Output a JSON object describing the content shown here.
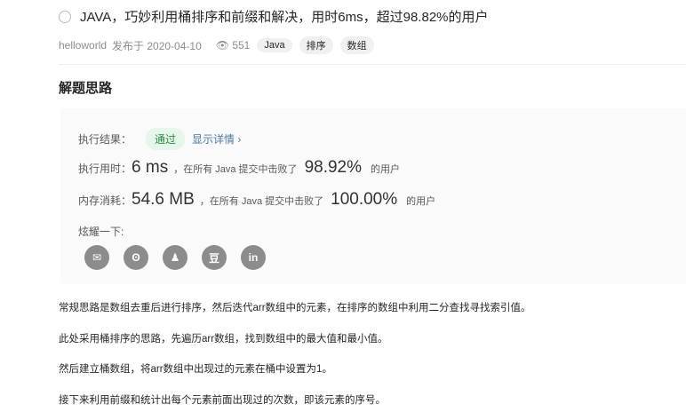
{
  "post": {
    "title": "JAVA，巧妙利用桶排序和前缀和解决，用时6ms，超过98.82%的用户",
    "author": "helloworld",
    "date": "发布于 2020-04-10",
    "views": "551",
    "tags": [
      "Java",
      "排序",
      "数组"
    ]
  },
  "section_title": "解题思路",
  "result": {
    "label": "执行结果：",
    "status": "通过",
    "detail_link": "显示详情 ›",
    "time_label": "执行用时：",
    "time_value": "6 ms",
    "time_mid": "，在所有 Java 提交中击败了",
    "time_pct": "98.92%",
    "time_suffix": "的用户",
    "mem_label": "内存消耗：",
    "mem_value": "54.6 MB",
    "mem_mid": "，在所有 Java 提交中击败了",
    "mem_pct": "100.00%",
    "mem_suffix": "的用户",
    "share_label": "炫耀一下:",
    "share_icons": [
      "wechat-icon",
      "weibo-icon",
      "qq-icon",
      "douban-icon",
      "linkedin-icon"
    ],
    "share_glyphs": [
      "✉",
      "ʘ",
      "♟",
      "豆",
      "in"
    ]
  },
  "paragraphs": [
    "常规思路是数组去重后进行排序，然后迭代arr数组中的元素，在排序的数组中利用二分查找寻找索引值。",
    "此处采用桶排序的思路，先遍历arr数组，找到数组中的最大值和最小值。",
    "然后建立桶数组，将arr数组中出现过的元素在桶中设置为1。",
    "接下来利用前缀和统计出每个元素前面出现过的次数，即该元素的序号。"
  ]
}
